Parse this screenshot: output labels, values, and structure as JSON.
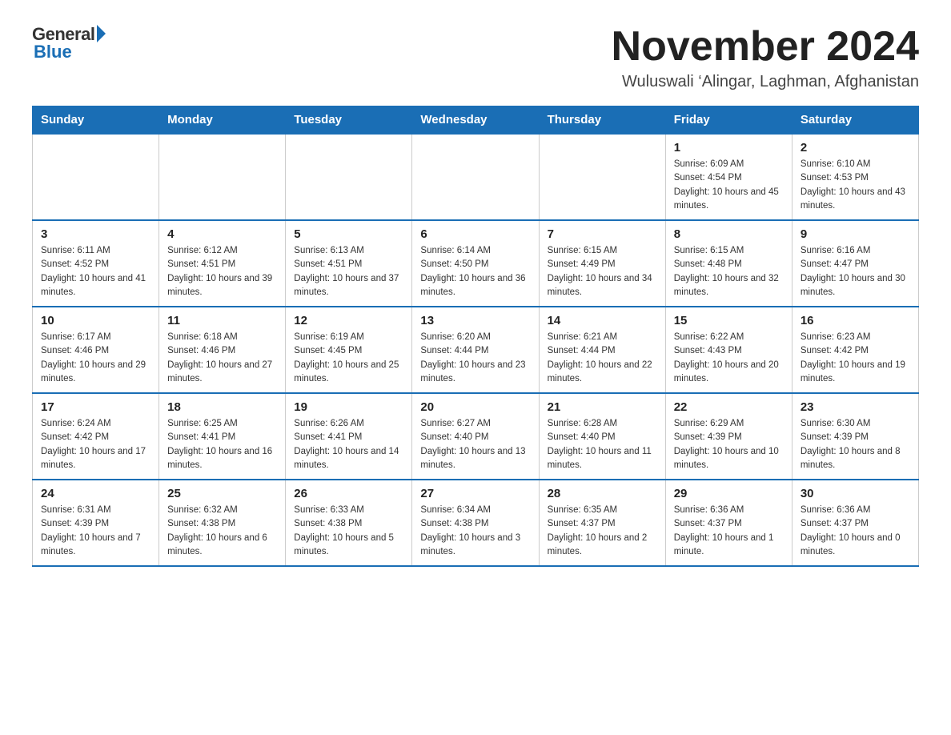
{
  "header": {
    "logo_general": "General",
    "logo_blue": "Blue",
    "title": "November 2024",
    "subtitle": "Wuluswali ‘Alingar, Laghman, Afghanistan"
  },
  "columns": [
    "Sunday",
    "Monday",
    "Tuesday",
    "Wednesday",
    "Thursday",
    "Friday",
    "Saturday"
  ],
  "weeks": [
    [
      {
        "day": "",
        "detail": ""
      },
      {
        "day": "",
        "detail": ""
      },
      {
        "day": "",
        "detail": ""
      },
      {
        "day": "",
        "detail": ""
      },
      {
        "day": "",
        "detail": ""
      },
      {
        "day": "1",
        "detail": "Sunrise: 6:09 AM\nSunset: 4:54 PM\nDaylight: 10 hours and 45 minutes."
      },
      {
        "day": "2",
        "detail": "Sunrise: 6:10 AM\nSunset: 4:53 PM\nDaylight: 10 hours and 43 minutes."
      }
    ],
    [
      {
        "day": "3",
        "detail": "Sunrise: 6:11 AM\nSunset: 4:52 PM\nDaylight: 10 hours and 41 minutes."
      },
      {
        "day": "4",
        "detail": "Sunrise: 6:12 AM\nSunset: 4:51 PM\nDaylight: 10 hours and 39 minutes."
      },
      {
        "day": "5",
        "detail": "Sunrise: 6:13 AM\nSunset: 4:51 PM\nDaylight: 10 hours and 37 minutes."
      },
      {
        "day": "6",
        "detail": "Sunrise: 6:14 AM\nSunset: 4:50 PM\nDaylight: 10 hours and 36 minutes."
      },
      {
        "day": "7",
        "detail": "Sunrise: 6:15 AM\nSunset: 4:49 PM\nDaylight: 10 hours and 34 minutes."
      },
      {
        "day": "8",
        "detail": "Sunrise: 6:15 AM\nSunset: 4:48 PM\nDaylight: 10 hours and 32 minutes."
      },
      {
        "day": "9",
        "detail": "Sunrise: 6:16 AM\nSunset: 4:47 PM\nDaylight: 10 hours and 30 minutes."
      }
    ],
    [
      {
        "day": "10",
        "detail": "Sunrise: 6:17 AM\nSunset: 4:46 PM\nDaylight: 10 hours and 29 minutes."
      },
      {
        "day": "11",
        "detail": "Sunrise: 6:18 AM\nSunset: 4:46 PM\nDaylight: 10 hours and 27 minutes."
      },
      {
        "day": "12",
        "detail": "Sunrise: 6:19 AM\nSunset: 4:45 PM\nDaylight: 10 hours and 25 minutes."
      },
      {
        "day": "13",
        "detail": "Sunrise: 6:20 AM\nSunset: 4:44 PM\nDaylight: 10 hours and 23 minutes."
      },
      {
        "day": "14",
        "detail": "Sunrise: 6:21 AM\nSunset: 4:44 PM\nDaylight: 10 hours and 22 minutes."
      },
      {
        "day": "15",
        "detail": "Sunrise: 6:22 AM\nSunset: 4:43 PM\nDaylight: 10 hours and 20 minutes."
      },
      {
        "day": "16",
        "detail": "Sunrise: 6:23 AM\nSunset: 4:42 PM\nDaylight: 10 hours and 19 minutes."
      }
    ],
    [
      {
        "day": "17",
        "detail": "Sunrise: 6:24 AM\nSunset: 4:42 PM\nDaylight: 10 hours and 17 minutes."
      },
      {
        "day": "18",
        "detail": "Sunrise: 6:25 AM\nSunset: 4:41 PM\nDaylight: 10 hours and 16 minutes."
      },
      {
        "day": "19",
        "detail": "Sunrise: 6:26 AM\nSunset: 4:41 PM\nDaylight: 10 hours and 14 minutes."
      },
      {
        "day": "20",
        "detail": "Sunrise: 6:27 AM\nSunset: 4:40 PM\nDaylight: 10 hours and 13 minutes."
      },
      {
        "day": "21",
        "detail": "Sunrise: 6:28 AM\nSunset: 4:40 PM\nDaylight: 10 hours and 11 minutes."
      },
      {
        "day": "22",
        "detail": "Sunrise: 6:29 AM\nSunset: 4:39 PM\nDaylight: 10 hours and 10 minutes."
      },
      {
        "day": "23",
        "detail": "Sunrise: 6:30 AM\nSunset: 4:39 PM\nDaylight: 10 hours and 8 minutes."
      }
    ],
    [
      {
        "day": "24",
        "detail": "Sunrise: 6:31 AM\nSunset: 4:39 PM\nDaylight: 10 hours and 7 minutes."
      },
      {
        "day": "25",
        "detail": "Sunrise: 6:32 AM\nSunset: 4:38 PM\nDaylight: 10 hours and 6 minutes."
      },
      {
        "day": "26",
        "detail": "Sunrise: 6:33 AM\nSunset: 4:38 PM\nDaylight: 10 hours and 5 minutes."
      },
      {
        "day": "27",
        "detail": "Sunrise: 6:34 AM\nSunset: 4:38 PM\nDaylight: 10 hours and 3 minutes."
      },
      {
        "day": "28",
        "detail": "Sunrise: 6:35 AM\nSunset: 4:37 PM\nDaylight: 10 hours and 2 minutes."
      },
      {
        "day": "29",
        "detail": "Sunrise: 6:36 AM\nSunset: 4:37 PM\nDaylight: 10 hours and 1 minute."
      },
      {
        "day": "30",
        "detail": "Sunrise: 6:36 AM\nSunset: 4:37 PM\nDaylight: 10 hours and 0 minutes."
      }
    ]
  ]
}
